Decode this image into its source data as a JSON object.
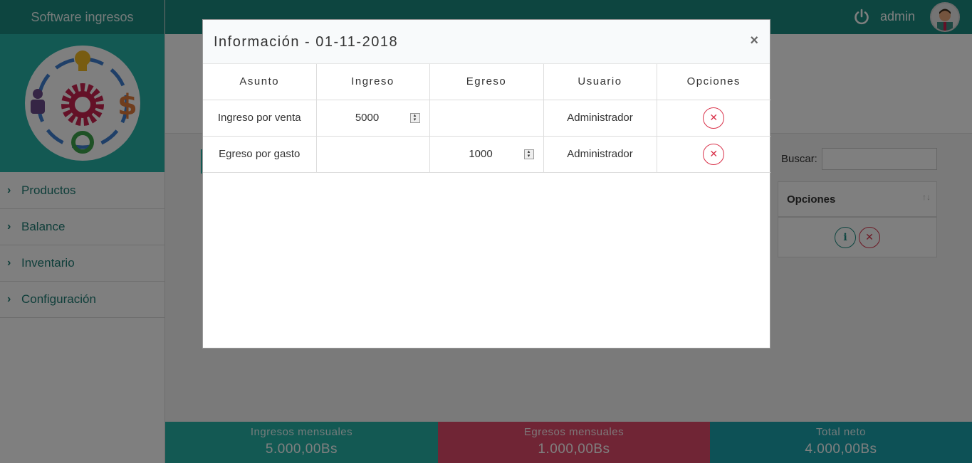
{
  "app": {
    "brand": "Software ingresos",
    "user": "admin"
  },
  "sidebar": {
    "items": [
      {
        "label": "Productos"
      },
      {
        "label": "Balance"
      },
      {
        "label": "Inventario"
      },
      {
        "label": "Configuración"
      }
    ]
  },
  "background": {
    "search_label": "Buscar:",
    "table_header": "Opciones"
  },
  "footer": {
    "income": {
      "label": "Ingresos mensuales",
      "value": "5.000,00Bs"
    },
    "expense": {
      "label": "Egresos mensuales",
      "value": "1.000,00Bs"
    },
    "net": {
      "label": "Total neto",
      "value": "4.000,00Bs"
    }
  },
  "modal": {
    "title": "Información - 01-11-2018",
    "close": "×",
    "columns": [
      "Asunto",
      "Ingreso",
      "Egreso",
      "Usuario",
      "Opciones"
    ],
    "rows": [
      {
        "asunto": "Ingreso por venta",
        "ingreso": "5000",
        "egreso": "",
        "usuario": "Administrador"
      },
      {
        "asunto": "Egreso por gasto",
        "ingreso": "",
        "egreso": "1000",
        "usuario": "Administrador"
      }
    ]
  },
  "colors": {
    "primary": "#26b3a7",
    "dark_primary": "#1a8a80",
    "danger": "#e04a6a",
    "net": "#1aa3ad"
  },
  "icons": {
    "power": "power-icon",
    "avatar": "avatar-icon",
    "chevron": "chevron-right-icon",
    "info": "info-icon",
    "delete": "close-circle-icon",
    "sort": "sort-icon"
  }
}
